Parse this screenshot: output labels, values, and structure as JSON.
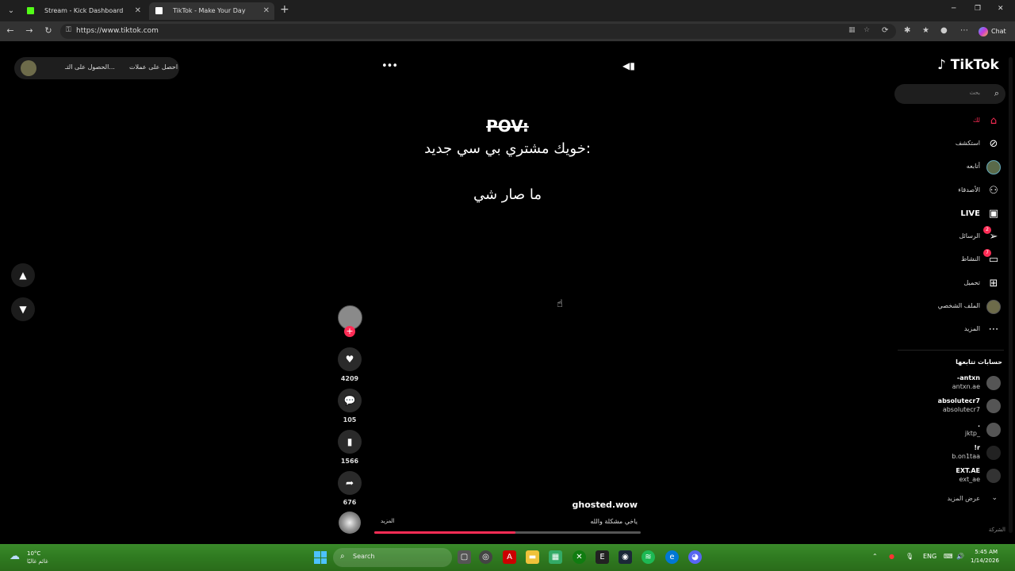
{
  "browser": {
    "tabs": [
      {
        "title": "Stream - Kick Dashboard",
        "favicon_color": "#53fc18"
      },
      {
        "title": "TikTok - Make Your Day",
        "favicon_color": "#ffffff"
      }
    ],
    "url": "https://www.tiktok.com",
    "chat_label": "Chat"
  },
  "top_pill": {
    "get_coins": "احصل على عملات",
    "get_app": "الحصول على التـ..."
  },
  "video": {
    "pov": "POV:",
    "caption_line1": "خويك مشتري بي سي جديد:",
    "caption_line2": "ما صار شي",
    "author": "ghosted.wow",
    "description": "ياخي مشكلة والله",
    "more": "المزيد",
    "progress": 0.53
  },
  "actions": {
    "likes": "4209",
    "comments": "105",
    "saves": "1566",
    "shares": "676"
  },
  "sidebar": {
    "logo": "TikTok",
    "search_placeholder": "بحث",
    "nav": [
      {
        "label": "لك",
        "icon": "home-icon"
      },
      {
        "label": "استكشف",
        "icon": "compass-icon"
      },
      {
        "label": "أتابعه",
        "icon": "avatar-icon"
      },
      {
        "label": "الأصدقاء",
        "icon": "friends-icon"
      },
      {
        "label": "LIVE",
        "icon": "live-icon"
      },
      {
        "label": "الرسائل",
        "icon": "messages-icon",
        "badge": "2"
      },
      {
        "label": "النشاط",
        "icon": "activity-icon",
        "badge": "7"
      },
      {
        "label": "تحميل",
        "icon": "upload-icon"
      },
      {
        "label": "الملف الشخصي",
        "icon": "profile-icon"
      },
      {
        "label": "المزيد",
        "icon": "more-icon"
      }
    ],
    "following_title": "حسابات تتابعها",
    "accounts": [
      {
        "name": "-antxn",
        "handle": "antxn.ae"
      },
      {
        "name": "absolutecr7",
        "handle": "absolutecr7"
      },
      {
        "name": ".",
        "handle": "jktp_"
      },
      {
        "name": "!r",
        "handle": "b.on1taa"
      },
      {
        "name": "EXT.AE",
        "handle": "ext_ae"
      }
    ],
    "see_more": "عرض المزيد",
    "company": "الشركة"
  },
  "taskbar": {
    "temperature": "10°C",
    "weather_location": "غائم غالبًا",
    "search": "Search",
    "lang": "ENG",
    "time": "5:45 AM",
    "date": "1/14/2026"
  }
}
